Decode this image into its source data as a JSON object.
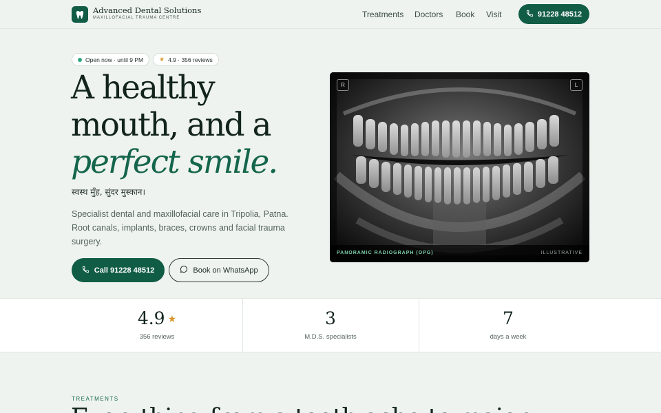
{
  "brand": {
    "name": "Advanced Dental Solutions",
    "subtitle": "MAXILLOFACIAL TRAUMA CENTRE"
  },
  "nav": {
    "items": [
      "Treatments",
      "Doctors",
      "Book",
      "Visit"
    ],
    "cta": "91228 48512"
  },
  "pills": {
    "open": "Open now · until 9 PM",
    "rating": "4.9 · 356 reviews"
  },
  "hero": {
    "line1": "A healthy",
    "line2": "mouth, and a",
    "line3": "perfect smile.",
    "hindi": "स्वस्थ मुँह, सुंदर मुस्कान।",
    "description": "Specialist dental and maxillofacial care in Tripolia, Patna. Root canals, implants, braces, crowns and facial trauma surgery.",
    "primary_button": "Call 91228 48512",
    "secondary_button": "Book on WhatsApp"
  },
  "xray": {
    "tag_left": "R",
    "tag_right": "L",
    "caption": "PANORAMIC RADIOGRAPH (OPG)",
    "note": "ILLUSTRATIVE"
  },
  "stats": [
    {
      "value": "4.9",
      "label": "356 reviews"
    },
    {
      "value": "3",
      "label": "M.D.S. specialists"
    },
    {
      "value": "7",
      "label": "days a week"
    }
  ],
  "section": {
    "eyebrow": "TREATMENTS",
    "heading": "Everything from a tooth ache to major"
  },
  "colors": {
    "accent": "#115c45",
    "star": "#d9962b",
    "background": "#eef3f0"
  },
  "icons": {
    "logo": "tooth-icon",
    "phone": "phone-icon",
    "whatsapp": "chat-icon",
    "star": "star-icon"
  }
}
